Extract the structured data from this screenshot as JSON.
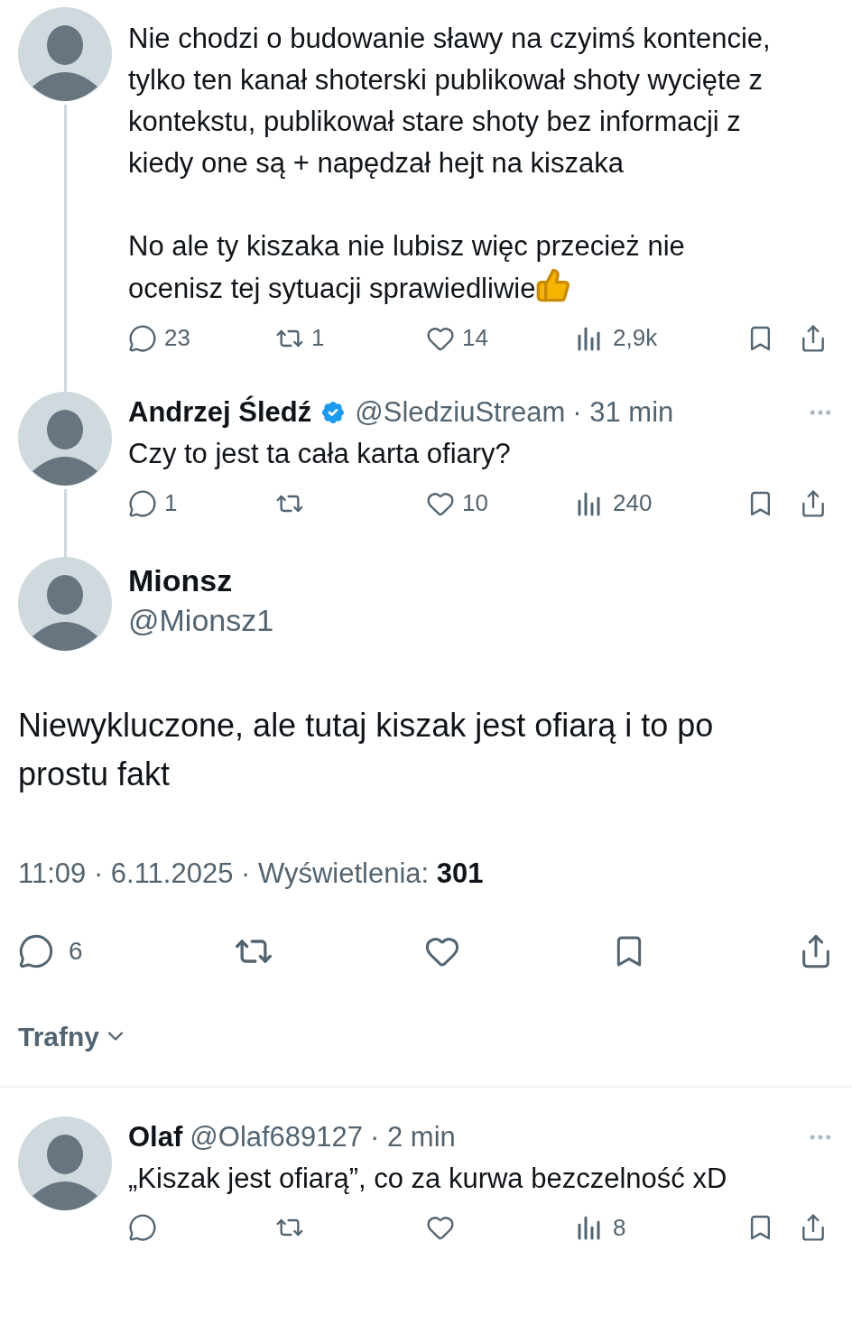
{
  "thread": [
    {
      "paragraphs": [
        "Nie chodzi o budowanie sławy na czyimś kontencie, tylko ten kanał shoterski publikował shoty wycięte z kontekstu, publikował stare shoty bez informacji z kiedy one są + napędzał hejt na kiszaka",
        "No ale ty kiszaka nie lubisz więc przecież nie ocenisz tej sytuacji sprawiedliwie"
      ],
      "thumbs_up": true,
      "stats": {
        "replies": "23",
        "reposts": "1",
        "likes": "14",
        "views": "2,9k"
      }
    },
    {
      "name": "Andrzej Śledź",
      "verified": true,
      "handle": "@SledziuStream",
      "time": "· 31 min",
      "paragraphs": [
        "Czy to jest ta cała karta ofiary?"
      ],
      "stats": {
        "replies": "1",
        "likes": "10",
        "views": "240"
      }
    }
  ],
  "main": {
    "name": "Mionsz",
    "handle": "@Mionsz1",
    "text": "Niewykluczone, ale tutaj kiszak jest ofiarą i to po prostu fakt",
    "meta": "11:09 · 6.11.2025 · Wyświetlenia: **301**",
    "stats": {
      "replies": "6"
    }
  },
  "sort": {
    "label": "Trafny"
  },
  "replies": [
    {
      "name": "Olaf",
      "handle": "@Olaf689127",
      "time": "· 2 min",
      "paragraphs": [
        "„Kiszak jest ofiarą”, co za kurwa bezczelność xD"
      ],
      "stats": {
        "views": "8"
      }
    }
  ]
}
